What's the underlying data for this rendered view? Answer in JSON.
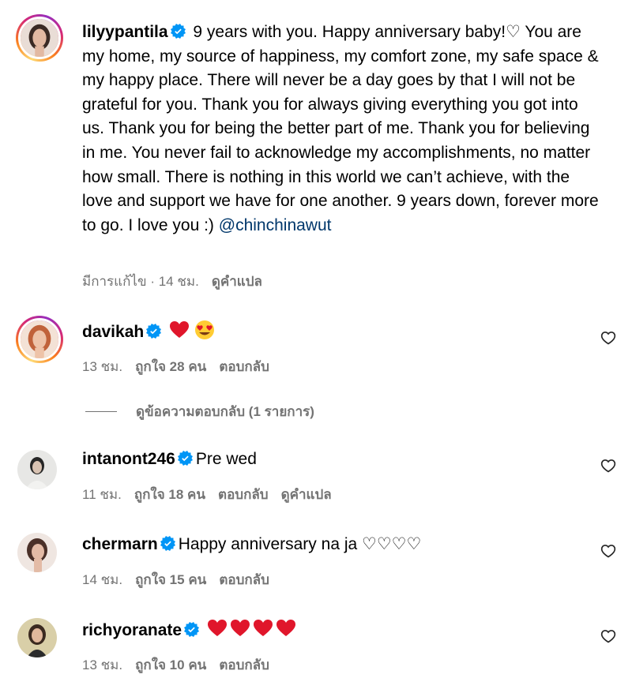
{
  "caption": {
    "username": "lilyypantila",
    "text_before_mention": " 9 years with you. Happy anniversary baby!♡ You are my home, my source of happiness, my comfort zone, my safe space & my happy place. There will never be a day goes by that I will not be grateful for you. Thank you for always giving everything you got into us. Thank you for being the better part of me. Thank you for believing in me. You never fail to acknowledge my accomplishments, no matter how small. There is nothing in this world we can’t achieve, with the love and support we have for one another. 9 years down, forever more to go. I love you :) ",
    "mention": "@chinchinawut",
    "edited": "มีการแก้ไข · 14 ชม.",
    "translate": "ดูคำแปล"
  },
  "comments": [
    {
      "username": "davikah",
      "text": "❤️😍",
      "time": "13 ชม.",
      "likes": "ถูกใจ 28 คน",
      "reply": "ตอบกลับ",
      "translate": ""
    },
    {
      "username": "intanont246",
      "text": "Pre wed",
      "time": "11 ชม.",
      "likes": "ถูกใจ 18 คน",
      "reply": "ตอบกลับ",
      "translate": "ดูคำแปล"
    },
    {
      "username": "chermarn",
      "text": "Happy anniversary na ja ♡♡♡♡",
      "time": "14 ชม.",
      "likes": "ถูกใจ 15 คน",
      "reply": "ตอบกลับ",
      "translate": ""
    },
    {
      "username": "richyoranate",
      "text": "❤️❤️❤️❤️",
      "time": "13 ชม.",
      "likes": "ถูกใจ 10 คน",
      "reply": "ตอบกลับ",
      "translate": ""
    }
  ],
  "view_replies": "ดูข้อความตอบกลับ (1 รายการ)",
  "colors": {
    "verified": "#0095f6",
    "heart_red": "#ff3040",
    "meta_grey": "#737373",
    "mention_blue": "#00376b"
  },
  "icons": [
    "verified-badge-icon",
    "heart-outline-icon",
    "red-heart-emoji",
    "heart-eyes-emoji"
  ]
}
